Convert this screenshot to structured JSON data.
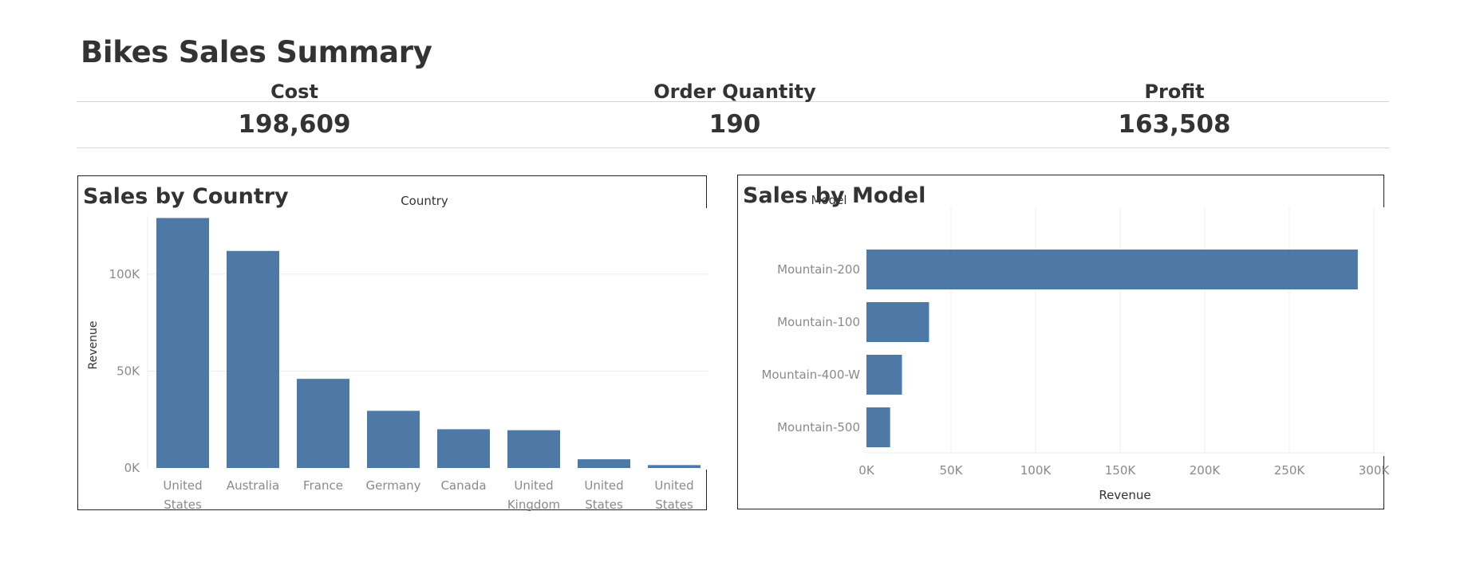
{
  "dashboard": {
    "title": "Bikes Sales Summary"
  },
  "kpis": [
    {
      "label": "Cost",
      "value": "198,609"
    },
    {
      "label": "Order Quantity",
      "value": "190"
    },
    {
      "label": "Profit",
      "value": "163,508"
    }
  ],
  "colors": {
    "bar": "#4e79a7",
    "text": "#333333",
    "axis_text": "#8a8a8a",
    "grid": "#ececec"
  },
  "chart_data": [
    {
      "type": "bar",
      "orientation": "vertical",
      "title": "Sales by Country",
      "header": "Country",
      "xlabel": "",
      "ylabel": "Revenue",
      "categories": [
        [
          "United",
          "States"
        ],
        [
          "Australia"
        ],
        [
          "France"
        ],
        [
          "Germany"
        ],
        [
          "Canada"
        ],
        [
          "United",
          "Kingdom"
        ],
        [
          "United",
          "States"
        ],
        [
          "United",
          "States"
        ]
      ],
      "values": [
        129000,
        112000,
        46000,
        29500,
        20000,
        19500,
        4500,
        1500
      ],
      "ylim": [
        0,
        130000
      ],
      "yticks": [
        0,
        50000,
        100000
      ],
      "ytick_labels": [
        "0K",
        "50K",
        "100K"
      ],
      "grid": true
    },
    {
      "type": "bar",
      "orientation": "horizontal",
      "title": "Sales by Model",
      "header": "Model",
      "xlabel": "Revenue",
      "ylabel": "",
      "categories": [
        "Mountain-200",
        "Mountain-100",
        "Mountain-400-W",
        "Mountain-500"
      ],
      "values": [
        290500,
        37000,
        21000,
        14000
      ],
      "xlim": [
        0,
        300000
      ],
      "xticks": [
        0,
        50000,
        100000,
        150000,
        200000,
        250000,
        300000
      ],
      "xtick_labels": [
        "0K",
        "50K",
        "100K",
        "150K",
        "200K",
        "250K",
        "300K"
      ],
      "grid": true
    }
  ]
}
